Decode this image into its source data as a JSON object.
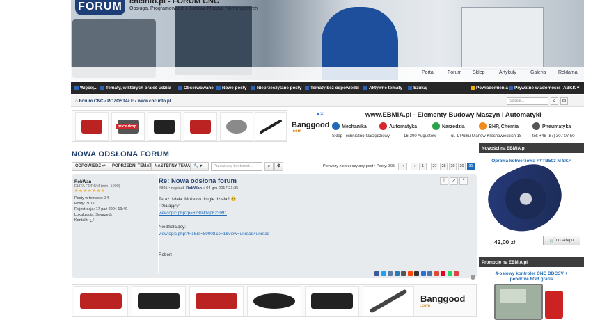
{
  "header": {
    "site_title": "cncinfo.pl - FORUM CNC",
    "site_desc": "Obsługa, Programowanie i Budowa Maszyn Numerycznych",
    "logo_text": "FORUM",
    "nav": [
      "Portal",
      "Forum",
      "Sklep",
      "Artykuły",
      "Galeria",
      "Reklama"
    ]
  },
  "topnav": {
    "more": "Więcej...",
    "links": [
      "Tematy, w których brałeś udział",
      "Obserwowane",
      "Nowe posty",
      "Nieprzeczytane posty",
      "Tematy bez odpowiedzi",
      "Aktywne tematy",
      "Szukaj"
    ],
    "notifications": "Powiadomienia",
    "pm": "Prywatne wiadomości",
    "user": "ABKK"
  },
  "breadcrumb": {
    "items": [
      "Forum CNC",
      "POZOSTAŁE",
      "www.cnc.info.pl"
    ],
    "search_placeholder": "Szukaj..."
  },
  "ads": {
    "top_strip_label": "price drop",
    "banggood": "Banggood",
    "banggood_sub": ".com",
    "ebmia_title": "www.EBMiA.pl - Elementy Budowy Maszyn i Automatyki",
    "categories": [
      "Mechanika",
      "Automatyka",
      "Narzędzia",
      "BHP, Chemia",
      "Pneumatyka"
    ],
    "footer": [
      "Sklep Techniczno-Narzędziowy",
      "16-300 Augustów",
      "ul. 1 Pułku Ułanów Krechowieckich 18",
      "tel: +48 (87) 307 07 50"
    ]
  },
  "topic": {
    "title": "NOWA ODSŁONA FORUM",
    "reply_btn": "ODPOWIEDZ",
    "prev_btn": "POPRZEDNI TEMAT",
    "next_btn": "NASTĘPNY TEMAT",
    "search_placeholder": "Przeszukaj ten temat...",
    "page_info": "Pierwszy nieprzeczytany post • Posty: 305",
    "pages": [
      "1",
      "…",
      "27",
      "28",
      "29",
      "30",
      "31"
    ]
  },
  "post": {
    "author": "RobWan",
    "rank": "ELITA FORUM (min. 1000)",
    "posts_in_topic": "Posty w temacie: 34",
    "posts": "Posty: 3017",
    "registered": "Rejestracja: 17 paź 2004 19:49",
    "location": "Lokalizacja: Swarzędz",
    "contact": "Kontakt:",
    "title": "Re: Nowa odsłona forum",
    "number": "#301",
    "meta_pre": "napisał:",
    "meta_user": "RobWan",
    "meta_date": "» 04 gru 2017 21:35",
    "line1": "Teraz działa. Może co drugie działa? 😉",
    "line2": "Działający:",
    "link1": "viewtopic.php?p=623991#p623991",
    "line3": "Niedziałający:",
    "link2": "viewtopic.php?f=16&t=89008&e=1&view=unread#unread",
    "signature": "Robert"
  },
  "sidebar": {
    "news_head": "Nowości na EBMiA.pl",
    "product": "Oprawa kołnierzowa FYTB503 M SKF",
    "price": "42,00 zł",
    "shop_btn": "do sklepu",
    "promo_head": "Promocje na EBMiA.pl",
    "promo_product": "4-osiowy kontroler CNC DDCSV + pendrive 8GB gratis"
  },
  "colors": {
    "accent": "#1f6bb8",
    "nav_bg": "#272727",
    "post_bg": "#e8ebee"
  }
}
